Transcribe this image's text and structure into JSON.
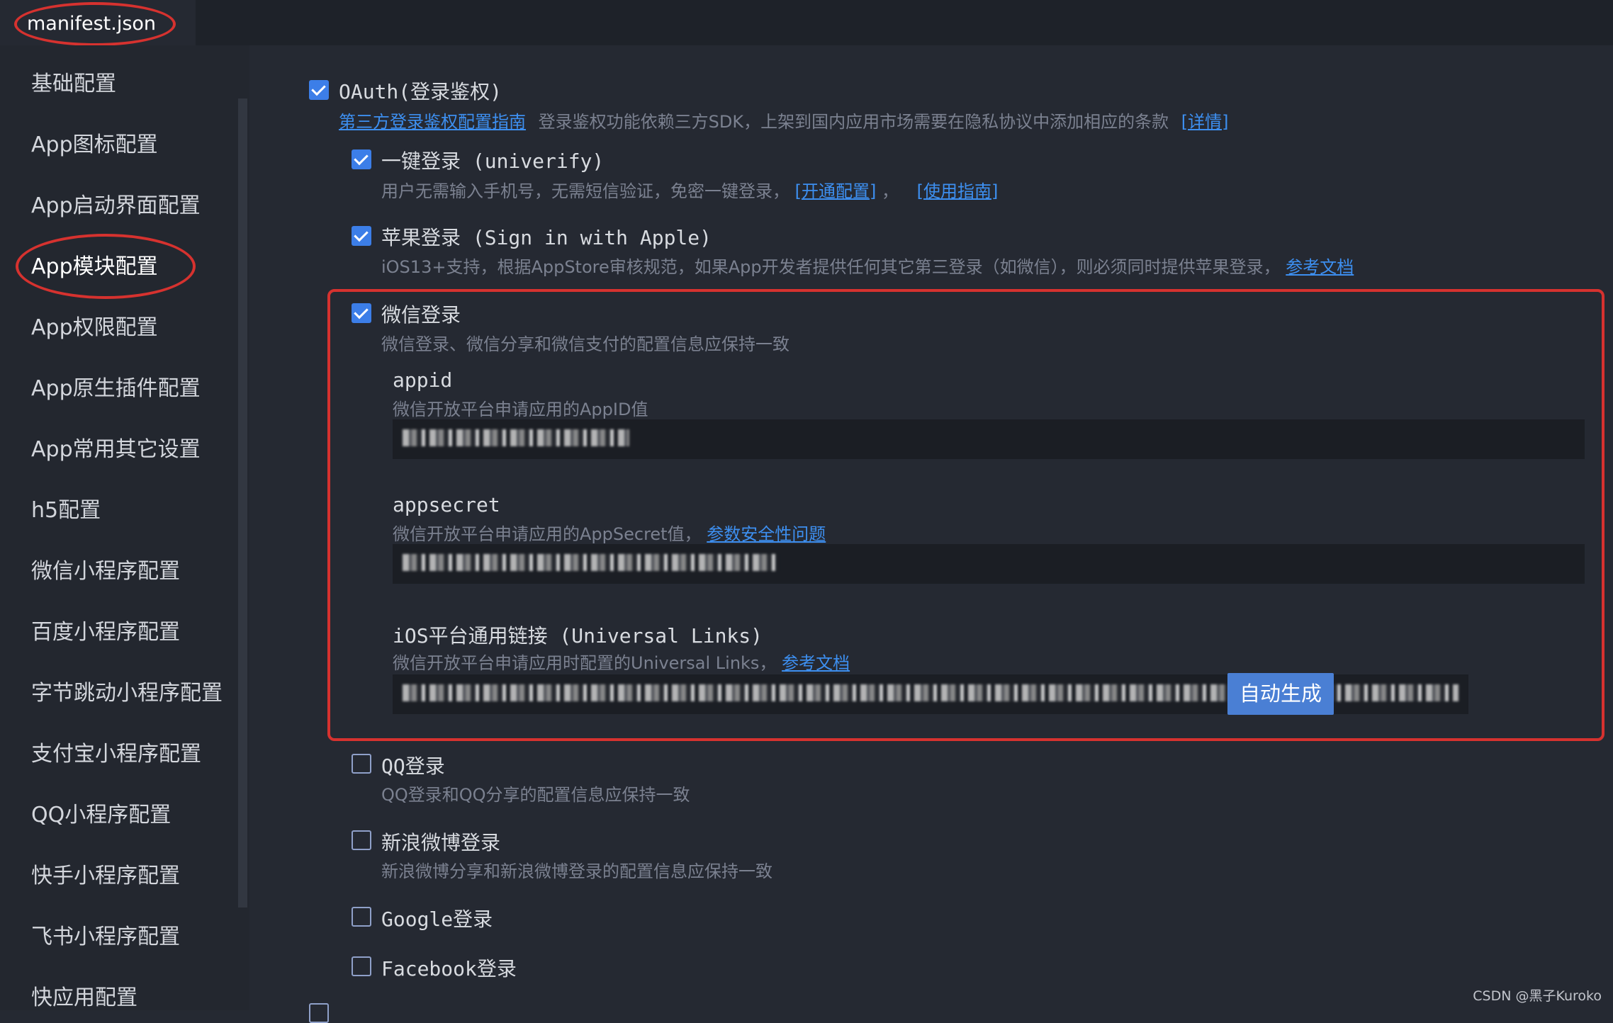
{
  "tab": {
    "label": "manifest.json"
  },
  "sidebar": {
    "items": [
      {
        "label": "基础配置"
      },
      {
        "label": "App图标配置"
      },
      {
        "label": "App启动界面配置"
      },
      {
        "label": "App模块配置"
      },
      {
        "label": "App权限配置"
      },
      {
        "label": "App原生插件配置"
      },
      {
        "label": "App常用其它设置"
      },
      {
        "label": "h5配置"
      },
      {
        "label": "微信小程序配置"
      },
      {
        "label": "百度小程序配置"
      },
      {
        "label": "字节跳动小程序配置"
      },
      {
        "label": "支付宝小程序配置"
      },
      {
        "label": "QQ小程序配置"
      },
      {
        "label": "快手小程序配置"
      },
      {
        "label": "飞书小程序配置"
      },
      {
        "label": "快应用配置"
      }
    ],
    "selected": "App模块配置"
  },
  "oauth": {
    "title": "OAuth(登录鉴权)",
    "checked": true,
    "guide_link": "第三方登录鉴权配置指南",
    "desc": "登录鉴权功能依赖三方SDK，上架到国内应用市场需要在隐私协议中添加相应的条款",
    "detail_link": "[详情]"
  },
  "univerify": {
    "title": "一键登录 (univerify)",
    "checked": true,
    "desc": "用户无需输入手机号，无需短信验证，免密一键登录，",
    "open_link": "[开通配置]",
    "sep": "，",
    "guide_link": "[使用指南]"
  },
  "apple": {
    "title": "苹果登录 (Sign in with Apple)",
    "checked": true,
    "desc": "iOS13+支持，根据AppStore审核规范，如果App开发者提供任何其它第三登录（如微信），则必须同时提供苹果登录，",
    "doc_link": "参考文档"
  },
  "weixin": {
    "title": "微信登录",
    "checked": true,
    "desc": "微信登录、微信分享和微信支付的配置信息应保持一致",
    "appid": {
      "label": "appid",
      "desc": "微信开放平台申请应用的AppID值"
    },
    "appsecret": {
      "label": "appsecret",
      "desc": "微信开放平台申请应用的AppSecret值，",
      "link": "参数安全性问题"
    },
    "universal": {
      "label": "iOS平台通用链接 (Universal Links)",
      "desc": "微信开放平台申请应用时配置的Universal Links，",
      "link": "参考文档"
    },
    "auto_button": "自动生成"
  },
  "qq": {
    "title": "QQ登录",
    "checked": false,
    "desc": "QQ登录和QQ分享的配置信息应保持一致"
  },
  "weibo": {
    "title": "新浪微博登录",
    "checked": false,
    "desc": "新浪微博分享和新浪微博登录的配置信息应保持一致"
  },
  "google": {
    "title": "Google登录",
    "checked": false
  },
  "facebook": {
    "title": "Facebook登录",
    "checked": false
  },
  "watermark": "CSDN @黑子Kuroko",
  "colors": {
    "accent": "#3c7ee8",
    "highlight": "#d6322f",
    "link": "#3d8ff0",
    "button": "#4a7fd4"
  }
}
